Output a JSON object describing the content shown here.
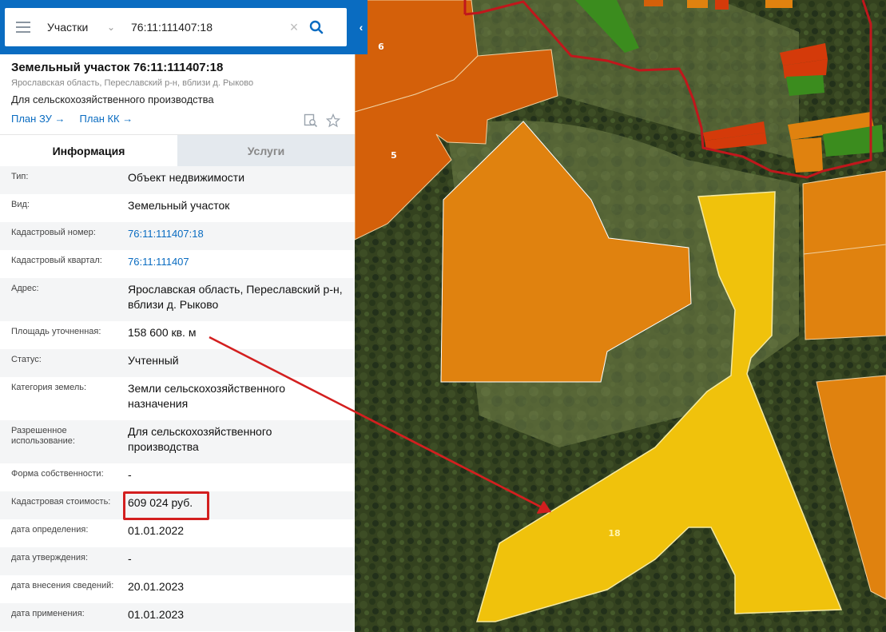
{
  "search": {
    "layer": "Участки",
    "query": "76:11:111407:18"
  },
  "parcel": {
    "title": "Земельный участок 76:11:111407:18",
    "subtitle": "Ярославская область, Переславский р-н, вблизи д. Рыково",
    "purpose": "Для сельскохозяйственного производства",
    "links": [
      "План ЗУ →",
      "План КК →"
    ]
  },
  "tabs": [
    "Информация",
    "Услуги"
  ],
  "info_rows": [
    {
      "label": "Тип:",
      "value": "Объект недвижимости"
    },
    {
      "label": "Вид:",
      "value": "Земельный участок"
    },
    {
      "label": "Кадастровый номер:",
      "value": "76:11:111407:18",
      "link": true
    },
    {
      "label": "Кадастровый квартал:",
      "value": "76:11:111407",
      "link": true
    },
    {
      "label": "Адрес:",
      "value": "Ярославская область, Переславский р-н, вблизи д. Рыково"
    },
    {
      "label": "Площадь уточненная:",
      "value": "158 600 кв. м"
    },
    {
      "label": "Статус:",
      "value": "Учтенный"
    },
    {
      "label": "Категория земель:",
      "value": "Земли сельскохозяйственного назначения"
    },
    {
      "label": "Разрешенное использование:",
      "value": "Для сельскохозяйственного производства"
    },
    {
      "label": "Форма собственности:",
      "value": "-"
    },
    {
      "label": "Кадастровая стоимость:",
      "value": "609 024 руб.",
      "highlight": true
    },
    {
      "label": "дата определения:",
      "value": "01.01.2022"
    },
    {
      "label": "дата утверждения:",
      "value": "-"
    },
    {
      "label": "дата внесения сведений:",
      "value": "20.01.2023"
    },
    {
      "label": "дата применения:",
      "value": "01.01.2023"
    }
  ],
  "map_labels": {
    "parcel_6": "6",
    "parcel_5": "5",
    "parcel_18": "18"
  },
  "colors": {
    "accent": "#0a6cc1",
    "highlight": "#d31f1f",
    "selected_parcel": "#f0c20c",
    "parcel_orange": "#e0820f",
    "parcel_dark": "#d4600a"
  }
}
